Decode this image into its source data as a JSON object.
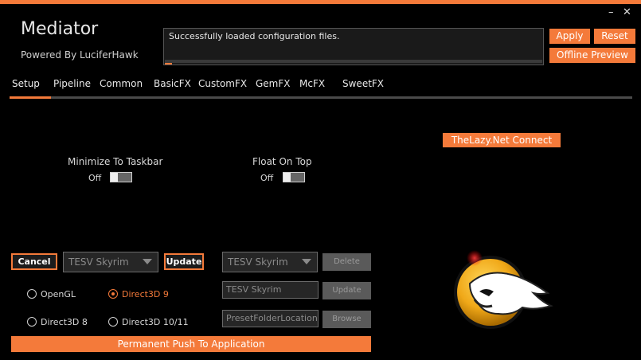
{
  "app": {
    "title": "Mediator",
    "subtitle": "Powered By LuciferHawk"
  },
  "window_controls": {
    "minimize": "–",
    "close": "✕"
  },
  "status": {
    "message": "Successfully loaded configuration files.",
    "progress": 0.02
  },
  "header_buttons": {
    "apply": "Apply",
    "reset": "Reset",
    "offline_preview": "Offline Preview"
  },
  "tabs": [
    {
      "label": "Setup",
      "active": true
    },
    {
      "label": "Pipeline",
      "active": false
    },
    {
      "label": "Common",
      "active": false
    },
    {
      "label": "BasicFX",
      "active": false
    },
    {
      "label": "CustomFX",
      "active": false
    },
    {
      "label": "GemFX",
      "active": false
    },
    {
      "label": "McFX",
      "active": false
    },
    {
      "label": "SweetFX",
      "active": false
    }
  ],
  "connect_button": "TheLazy.Net Connect",
  "minimize_taskbar": {
    "label": "Minimize To Taskbar",
    "state": "Off"
  },
  "float_on_top": {
    "label": "Float On Top",
    "state": "Off"
  },
  "game_panel": {
    "cancel": "Cancel",
    "selected_game": "TESV Skyrim",
    "update": "Update"
  },
  "renderers": [
    {
      "label": "OpenGL",
      "selected": false
    },
    {
      "label": "Direct3D 9",
      "selected": true
    },
    {
      "label": "Direct3D 8",
      "selected": false
    },
    {
      "label": "Direct3D 10/11",
      "selected": false
    }
  ],
  "preset_panel": {
    "selected_game": "TESV Skyrim",
    "delete": "Delete",
    "name_value": "TESV Skyrim",
    "update": "Update",
    "folder_value": "PresetFolderLocation",
    "browse": "Browse"
  },
  "push_button": "Permanent Push To Application",
  "colors": {
    "accent": "#f47a3a",
    "background": "#000000",
    "disabled": "#5a5a5a"
  },
  "logo": {
    "name": "mediator-hawk-logo"
  }
}
